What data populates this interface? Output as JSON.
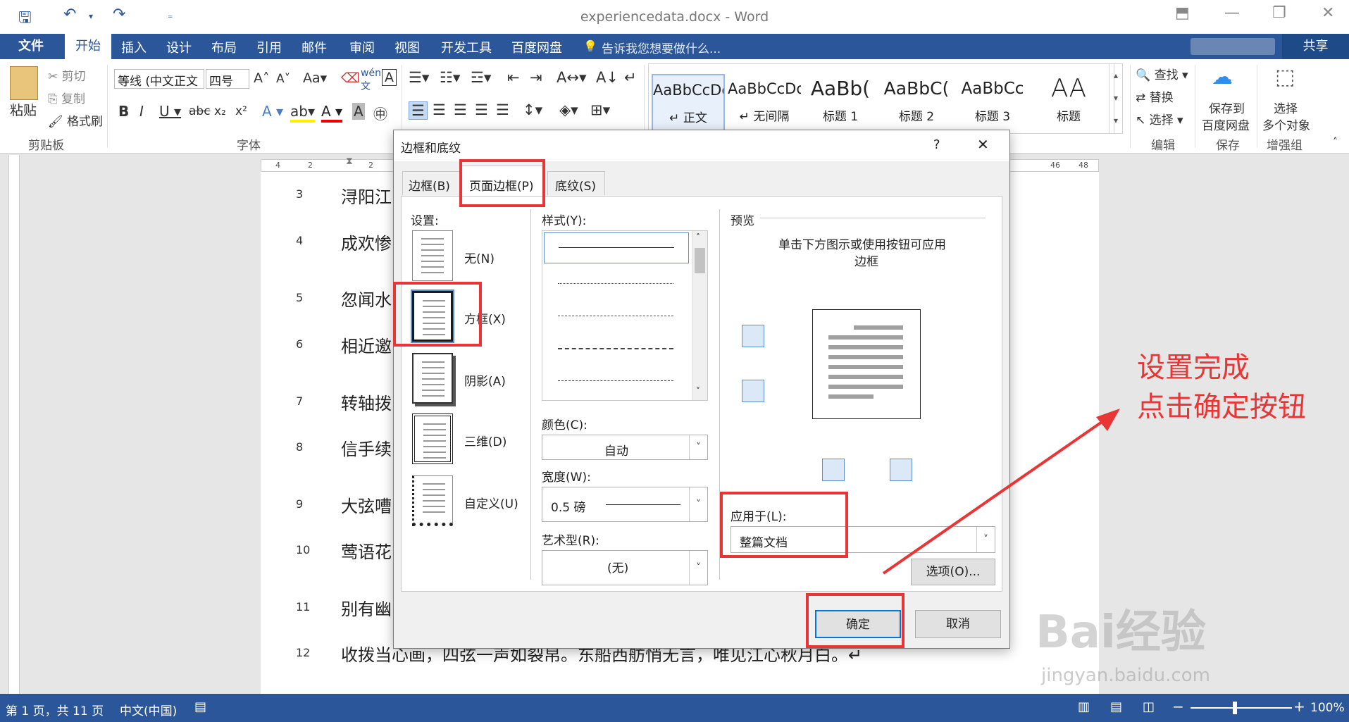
{
  "window": {
    "title": "experiencedata.docx - Word"
  },
  "menu": {
    "file": "文件",
    "tabs": [
      "开始",
      "插入",
      "设计",
      "布局",
      "引用",
      "邮件",
      "审阅",
      "视图",
      "开发工具",
      "百度网盘"
    ],
    "tell_me": "告诉我您想要做什么...",
    "share": "共享"
  },
  "ribbon": {
    "clipboard": {
      "paste": "粘贴",
      "cut": "剪切",
      "copy": "复制",
      "format_painter": "格式刷",
      "group": "剪贴板"
    },
    "font": {
      "name": "等线 (中文正文",
      "size": "四号",
      "group": "字体"
    },
    "styles": [
      {
        "sample": "AaBbCcDd",
        "name": "↵ 正文"
      },
      {
        "sample": "AaBbCcDd",
        "name": "↵ 无间隔"
      },
      {
        "sample": "AaBb(",
        "name": "标题 1"
      },
      {
        "sample": "AaBbC(",
        "name": "标题 2"
      },
      {
        "sample": "AaBbCc",
        "name": "标题 3"
      },
      {
        "sample": "AA",
        "name": "标题"
      }
    ],
    "edit": {
      "find": "查找",
      "replace": "替换",
      "select": "选择",
      "group": "编辑"
    },
    "save": {
      "label1": "保存到",
      "label2": "百度网盘",
      "group": "保存"
    },
    "enhance": {
      "label1": "选择",
      "label2": "多个对象",
      "group": "增强组"
    }
  },
  "ruler": {
    "left": [
      "4",
      "2",
      "2"
    ],
    "right": [
      "46",
      "48"
    ]
  },
  "document": {
    "lines": [
      {
        "num": "3",
        "text": "浔阳江"
      },
      {
        "num": "4",
        "text": "成欢惨"
      },
      {
        "num": "5",
        "text": "忽闻水"
      },
      {
        "num": "6",
        "text": "相近邀"
      },
      {
        "num": "7",
        "text": "转轴拨"
      },
      {
        "num": "8",
        "text": "信手续"
      },
      {
        "num": "9",
        "text": "大弦嘈"
      },
      {
        "num": "10",
        "text": "莺语花"
      },
      {
        "num": "11",
        "text": "别有幽"
      },
      {
        "num": "12",
        "text": "收拨当心画，四弦一声如裂帛。东船西舫悄无言，唯见江心秋月白。↵"
      }
    ]
  },
  "status": {
    "page": "第 1 页，共 11 页",
    "lang": "中文(中国)",
    "zoom": "100%"
  },
  "dialog": {
    "title": "边框和底纹",
    "help": "?",
    "close": "✕",
    "tabs": [
      "边框(B)",
      "页面边框(P)",
      "底纹(S)"
    ],
    "settings_label": "设置:",
    "settings": [
      "无(N)",
      "方框(X)",
      "阴影(A)",
      "三维(D)",
      "自定义(U)"
    ],
    "style_label": "样式(Y):",
    "color_label": "颜色(C):",
    "color_value": "自动",
    "width_label": "宽度(W):",
    "width_value": "0.5 磅",
    "art_label": "艺术型(R):",
    "art_value": "(无)",
    "preview_label": "预览",
    "preview_hint": "单击下方图示或使用按钮可应用",
    "preview_hint2": "边框",
    "apply_label": "应用于(L):",
    "apply_value": "整篇文档",
    "options": "选项(O)...",
    "ok": "确定",
    "cancel": "取消"
  },
  "annotation": {
    "line1": "设置完成",
    "line2": "点击确定按钮",
    "color": "#e83535"
  },
  "watermark": {
    "brand": "Bai经验",
    "url": "jingyan.baidu.com"
  }
}
